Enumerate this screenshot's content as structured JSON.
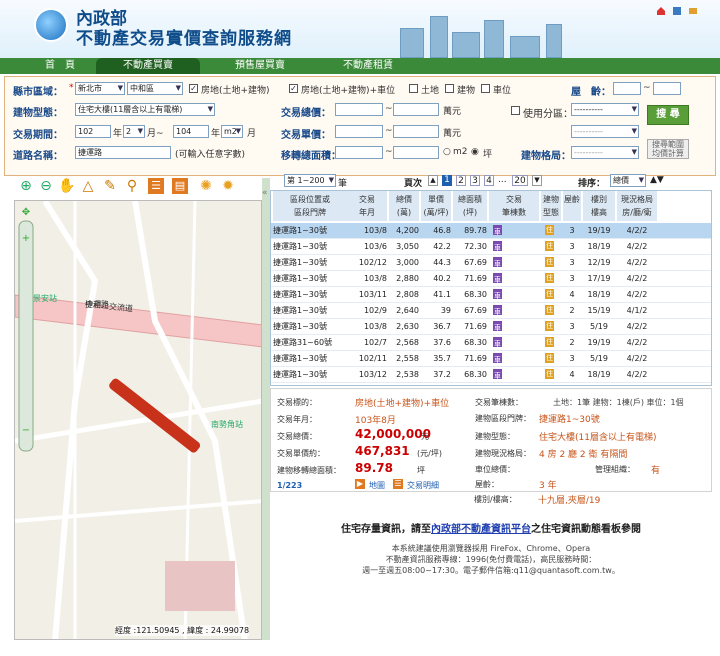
{
  "header": {
    "org": "內政部",
    "system": "不動產交易實價查詢服務網"
  },
  "nav": {
    "items": [
      "首　頁",
      "不動產買賣",
      "預售屋買賣",
      "不動產租賃"
    ],
    "active": 1
  },
  "form": {
    "county_label": "縣市區域：",
    "county": "新北市",
    "district": "中和區",
    "chk_land_build": "房地(土地+建物)",
    "chk_land_build_park": "房地(土地+建物)+車位",
    "chk_land": "土地",
    "chk_build": "建物",
    "chk_park": "車位",
    "age_label": "屋　齡：",
    "tilde": "~",
    "type_label": "建物型態：",
    "type_value": "住宅大樓(11層含以上有電梯)",
    "total_label": "交易總價：",
    "total_unit": "萬元",
    "use_label": "使用分區：",
    "use_value": "----------",
    "period_label": "交易期間：",
    "y1": "102",
    "m1": "2",
    "y2": "104",
    "m2": "m2",
    "y": "年",
    "m": "月",
    "to": "月~",
    "unit_label": "交易單價：",
    "unit_unit": "萬元",
    "use_value2": "----------",
    "road_label": "道路名稱：",
    "road_value": "捷運路",
    "road_hint": "(可輸入任意字數)",
    "area_label": "移轉總面積：",
    "ping": "坪",
    "layout_label": "建物格局：",
    "layout_value": "----------",
    "search_btn": "搜 尋",
    "calc_btn1": "搜尋範圍",
    "calc_btn2": "均價計算"
  },
  "map": {
    "coord": "經度 :121.50945 , 緯度 : 24.99078",
    "streets": [
      "中和二交流道",
      "捷運路",
      "福祥路",
      "景安站",
      "南勢角站",
      "安平路",
      "圓通路",
      "中和路",
      "中正路"
    ]
  },
  "toolbar": {
    "page_select": "第 1~200",
    "page_unit": "筆",
    "pages_label": "頁次",
    "pages": [
      "1",
      "2",
      "3",
      "4",
      "...",
      "20"
    ],
    "sort_label": "排序：",
    "sort_value": "總價"
  },
  "table": {
    "headers": [
      [
        "區段位置或",
        "區段門牌"
      ],
      [
        "交易",
        "年月"
      ],
      [
        "總價",
        "(萬)"
      ],
      [
        "單價",
        "(萬/坪)"
      ],
      [
        "總面積",
        "(坪)"
      ],
      [
        "交易",
        "筆棟數"
      ],
      [
        "建物",
        "型態"
      ],
      [
        "屋齡",
        ""
      ],
      [
        "樓別",
        "樓高"
      ],
      [
        "現況格局",
        "房/廳/衛"
      ]
    ],
    "rows": [
      {
        "addr": "捷運路1~30號",
        "date": "103/8",
        "total": "4,200",
        "unit": "46.8",
        "area": "89.78",
        "type": "住",
        "age": "3",
        "floor": "19/19",
        "layout": "4/2/2"
      },
      {
        "addr": "捷運路1~30號",
        "date": "103/6",
        "total": "3,050",
        "unit": "42.2",
        "area": "72.30",
        "type": "住",
        "age": "3",
        "floor": "18/19",
        "layout": "4/2/2"
      },
      {
        "addr": "捷運路1~30號",
        "date": "102/12",
        "total": "3,000",
        "unit": "44.3",
        "area": "67.69",
        "type": "住",
        "age": "3",
        "floor": "12/19",
        "layout": "4/2/2"
      },
      {
        "addr": "捷運路1~30號",
        "date": "103/8",
        "total": "2,880",
        "unit": "40.2",
        "area": "71.69",
        "type": "住",
        "age": "3",
        "floor": "17/19",
        "layout": "4/2/2"
      },
      {
        "addr": "捷運路1~30號",
        "date": "103/11",
        "total": "2,808",
        "unit": "41.1",
        "area": "68.30",
        "type": "住",
        "age": "4",
        "floor": "18/19",
        "layout": "4/2/2"
      },
      {
        "addr": "捷運路1~30號",
        "date": "102/9",
        "total": "2,640",
        "unit": "39",
        "area": "67.69",
        "type": "住",
        "age": "2",
        "floor": "15/19",
        "layout": "4/1/2"
      },
      {
        "addr": "捷運路1~30號",
        "date": "103/8",
        "total": "2,630",
        "unit": "36.7",
        "area": "71.69",
        "type": "住",
        "age": "3",
        "floor": "5/19",
        "layout": "4/2/2"
      },
      {
        "addr": "捷運路31~60號",
        "date": "102/7",
        "total": "2,568",
        "unit": "37.6",
        "area": "68.30",
        "type": "住",
        "age": "2",
        "floor": "19/19",
        "layout": "4/2/2"
      },
      {
        "addr": "捷運路1~30號",
        "date": "102/11",
        "total": "2,558",
        "unit": "35.7",
        "area": "71.69",
        "type": "住",
        "age": "3",
        "floor": "5/19",
        "layout": "4/2/2"
      },
      {
        "addr": "捷運路1~30號",
        "date": "103/12",
        "total": "2,538",
        "unit": "37.2",
        "area": "68.30",
        "type": "住",
        "age": "4",
        "floor": "18/19",
        "layout": "4/2/2"
      }
    ]
  },
  "detail": {
    "k_target": "交易標的：",
    "v_target": "房地(土地+建物)+車位",
    "k_date": "交易年月：",
    "v_date": "103年8月",
    "k_total": "交易總價：",
    "v_total": "42,000,000",
    "u_total": "元",
    "k_unit": "交易單價約：",
    "v_unit": "467,831",
    "u_unit": "(元/坪)",
    "k_area": "建物移轉總面積：",
    "v_area": "89.78",
    "u_area": "坪",
    "index": "1/223",
    "link_map": "地圖",
    "link_detail": "交易明細",
    "k_count": "交易筆棟數：",
    "v_count": "土地：1筆 建物：1棟(戶) 車位：1個",
    "k_addr": "建物區段門牌：",
    "v_addr": "捷運路1~30號",
    "k_type": "建物型態：",
    "v_type": "住宅大樓(11層含以上有電梯)",
    "k_layout": "建物現況格局：",
    "v_layout": "4 房 2 廳 2 衛 有隔間",
    "k_park": "車位總價：",
    "k_mgmt": "管理組織：",
    "v_mgmt": "有",
    "k_age": "屋齡：",
    "v_age": "3 年",
    "k_floor": "樓別/樓高：",
    "v_floor": "十九層,夾層/19"
  },
  "footer": {
    "headline_a": "住宅存量資訊，請至",
    "headline_link": "內政部不動產資訊平台",
    "headline_b": "之住宅資訊動態看板參閱",
    "l1": "本系統建議使用瀏覽器採用 FireFox、Chrome、Opera",
    "l2": "不動產資訊服務專線：1996(免付費電話)，高民服務時間：",
    "l3": "週一至週五08:00~17:30。電子郵件信箱:q11@quantasoft.com.tw。"
  },
  "colors": {
    "nav": "#3a8a3a",
    "accent": "#c8541a",
    "land": "#3a9a3a",
    "build": "#e07a20",
    "park": "#7a4ab0"
  }
}
